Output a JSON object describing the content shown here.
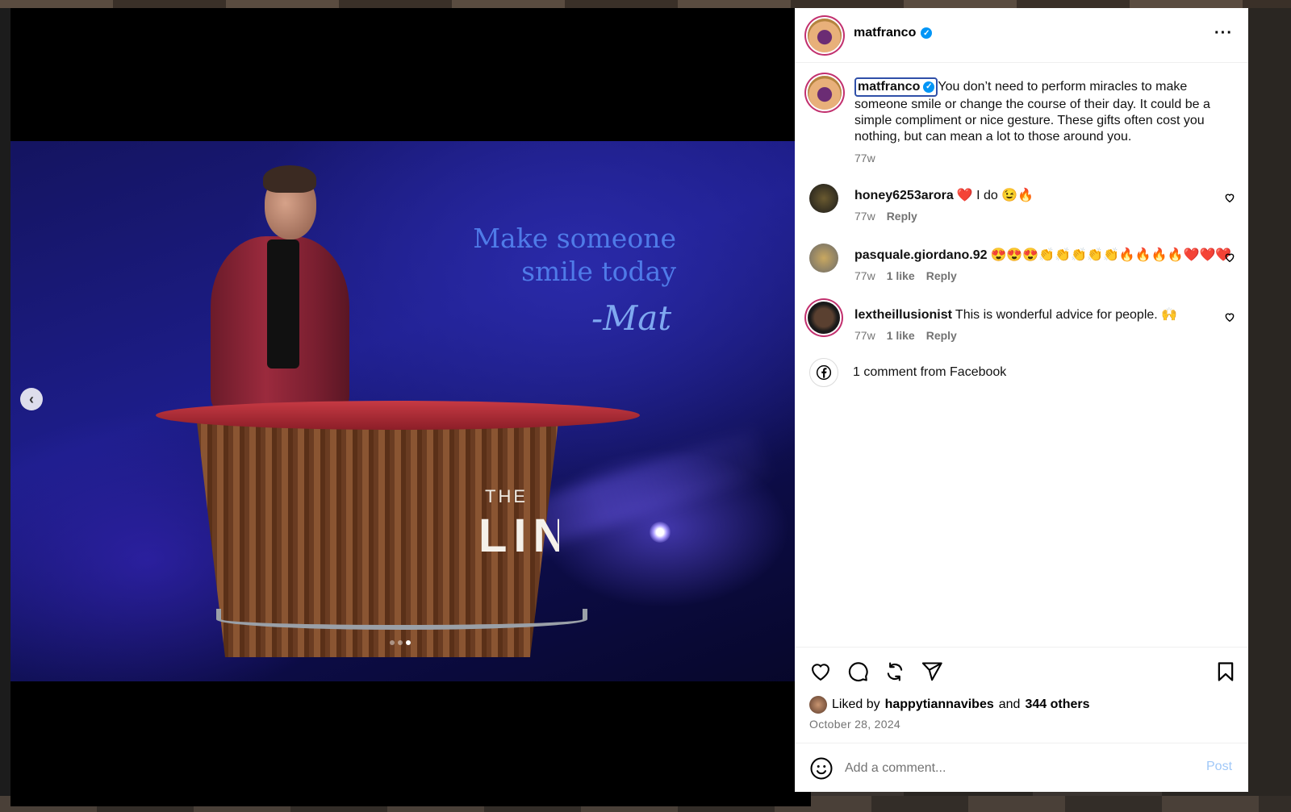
{
  "media": {
    "overlay_quote_line1": "Make someone",
    "overlay_quote_line2": "smile today",
    "signature": "-Mat",
    "podium_the": "THE",
    "podium_name": "LING",
    "carousel_count": 3,
    "carousel_active_index": 2
  },
  "header": {
    "username": "matfranco",
    "verified": true
  },
  "caption": {
    "username": "matfranco",
    "text": "You don’t need to perform miracles to make someone smile or change the course of their day. It could be a simple compliment or nice gesture. These gifts often cost you nothing, but can mean a lot to those around you.",
    "time": "77w"
  },
  "comments": [
    {
      "username": "honey6253arora",
      "text": "❤️ I do 😉🔥",
      "time": "77w",
      "likes": "",
      "reply": "Reply"
    },
    {
      "username": "pasquale.giordano.92",
      "text": "😍😍😍👏👏👏👏👏🔥🔥🔥🔥❤️❤️❤️",
      "time": "77w",
      "likes": "1 like",
      "reply": "Reply"
    },
    {
      "username": "lextheillusionist",
      "text": "This is wonderful advice for people. 🙌",
      "time": "77w",
      "likes": "1 like",
      "reply": "Reply"
    }
  ],
  "facebook_comments": "1 comment from Facebook",
  "likes": {
    "prefix": "Liked by",
    "user": "happytiannavibes",
    "middle": "and",
    "others": "344 others"
  },
  "post_date": "October 28, 2024",
  "comment_box": {
    "placeholder": "Add a comment...",
    "post_label": "Post"
  },
  "icons": [
    "more-icon",
    "heart-icon",
    "comment-icon",
    "repost-icon",
    "share-icon",
    "bookmark-icon",
    "emoji-icon",
    "facebook-icon",
    "chevron-left-icon",
    "verified-icon"
  ]
}
